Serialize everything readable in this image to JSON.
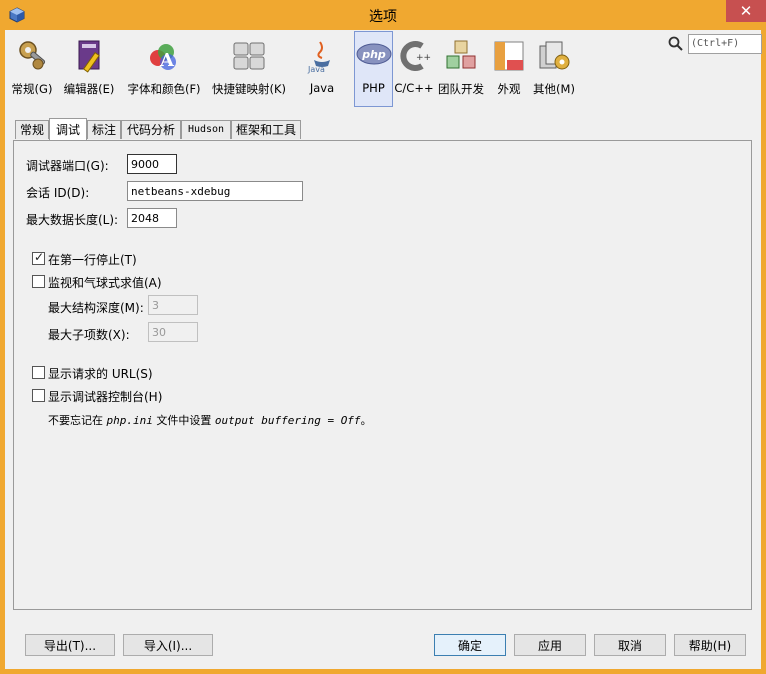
{
  "window": {
    "title": "选项"
  },
  "categories": [
    {
      "label": "常规(G)",
      "icon": "gear-wrench-icon"
    },
    {
      "label": "编辑器(E)",
      "icon": "editor-book-icon"
    },
    {
      "label": "字体和颜色(F)",
      "icon": "font-color-icon"
    },
    {
      "label": "快捷键映射(K)",
      "icon": "keyboard-icon"
    },
    {
      "label": "Java",
      "icon": "java-icon"
    },
    {
      "label": "PHP",
      "icon": "php-icon"
    },
    {
      "label": "C/C++",
      "icon": "cpp-icon"
    },
    {
      "label": "团队开发",
      "icon": "team-blocks-icon"
    },
    {
      "label": "外观",
      "icon": "appearance-icon"
    },
    {
      "label": "其他(M)",
      "icon": "misc-icon"
    }
  ],
  "search": {
    "placeholder": "(Ctrl+F)"
  },
  "tabs": [
    "常规",
    "调试",
    "标注",
    "代码分析",
    "Hudson",
    "框架和工具"
  ],
  "form": {
    "debugger_port_label": "调试器端口(G):",
    "debugger_port_value": "9000",
    "session_id_label": "会话 ID(D):",
    "session_id_value": "netbeans-xdebug",
    "max_data_length_label": "最大数据长度(L):",
    "max_data_length_value": "2048",
    "stop_first_line_label": "在第一行停止(T)",
    "watch_eval_label": "监视和气球式求值(A)",
    "max_struct_depth_label": "最大结构深度(M):",
    "max_struct_depth_value": "3",
    "max_children_label": "最大子项数(X):",
    "max_children_value": "30",
    "show_url_label": "显示请求的 URL(S)",
    "show_console_label": "显示调试器控制台(H)",
    "note_prefix": "不要忘记在 ",
    "note_file": "php.ini",
    "note_middle": " 文件中设置 ",
    "note_setting": "output buffering = Off",
    "note_suffix": "。"
  },
  "checkboxes": {
    "stop_first_line": true,
    "watch_eval": false,
    "show_url": false,
    "show_console": false
  },
  "buttons": {
    "export": "导出(T)...",
    "import": "导入(I)...",
    "ok": "确定",
    "apply": "应用",
    "cancel": "取消",
    "help": "帮助(H)"
  },
  "colors": {
    "titlebar": "#f0a830",
    "close": "#c75050",
    "selected_category": "#dfe6f8"
  }
}
